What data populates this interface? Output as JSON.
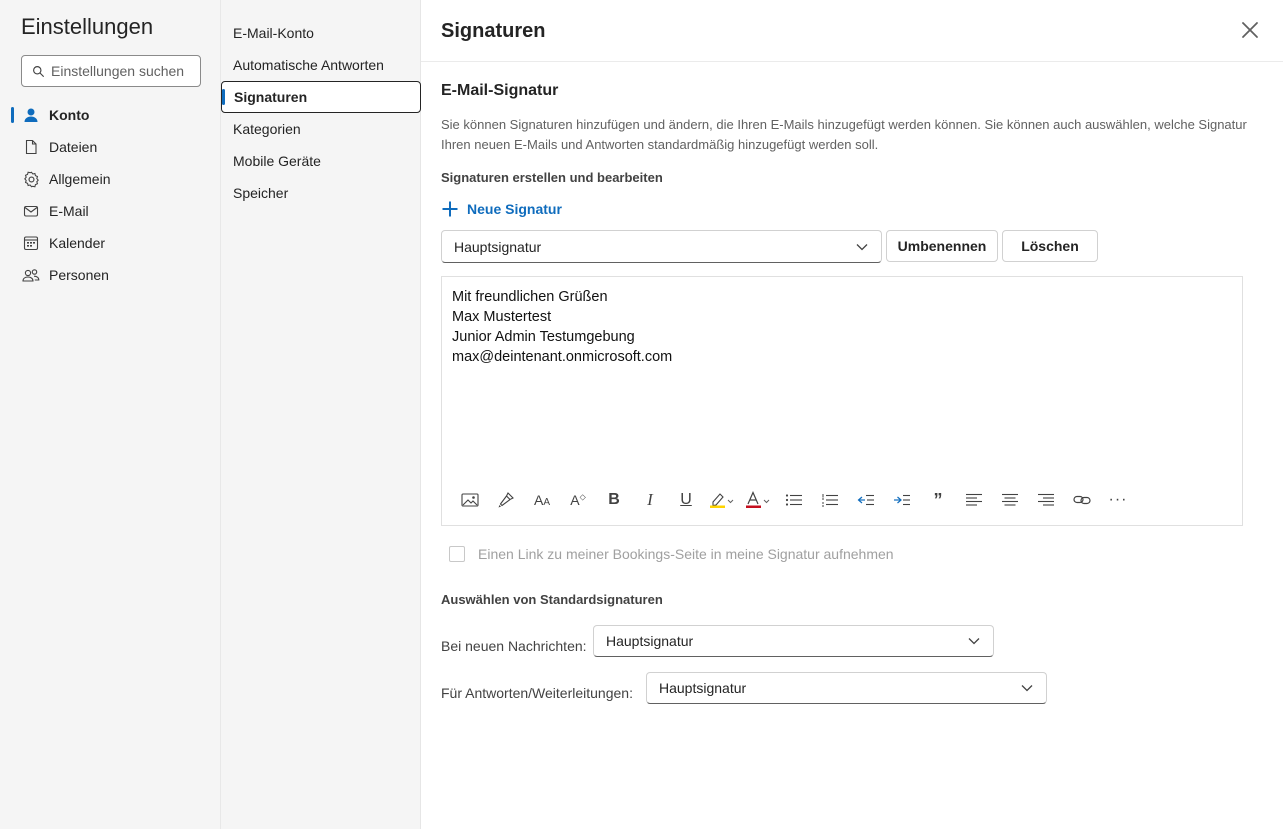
{
  "app": {
    "title": "Einstellungen",
    "search_placeholder": "Einstellungen suchen"
  },
  "nav": [
    {
      "label": "Konto",
      "icon": "person-icon",
      "active": true
    },
    {
      "label": "Dateien",
      "icon": "file-icon",
      "active": false
    },
    {
      "label": "Allgemein",
      "icon": "gear-icon",
      "active": false
    },
    {
      "label": "E-Mail",
      "icon": "mail-icon",
      "active": false
    },
    {
      "label": "Kalender",
      "icon": "calendar-icon",
      "active": false
    },
    {
      "label": "Personen",
      "icon": "people-icon",
      "active": false
    }
  ],
  "subnav": [
    {
      "label": "E-Mail-Konto",
      "active": false
    },
    {
      "label": "Automatische Antworten",
      "active": false
    },
    {
      "label": "Signaturen",
      "active": true
    },
    {
      "label": "Kategorien",
      "active": false
    },
    {
      "label": "Mobile Geräte",
      "active": false
    },
    {
      "label": "Speicher",
      "active": false
    }
  ],
  "panel": {
    "title": "Signaturen",
    "section_title": "E-Mail-Signatur",
    "description": "Sie können Signaturen hinzufügen und ändern, die Ihren E-Mails hinzugefügt werden können. Sie können auch auswählen, welche Signatur Ihren neuen E-Mails und Antworten standardmäßig hinzugefügt werden soll.",
    "create_title": "Signaturen erstellen und bearbeiten",
    "new_signature": "Neue Signatur",
    "selected_signature": "Hauptsignatur",
    "rename_button": "Umbenennen",
    "delete_button": "Löschen",
    "signature_lines": [
      "Mit freundlichen Grüßen",
      "Max Mustertest",
      "Junior Admin Testumgebung",
      "max@deintenant.onmicrosoft.com"
    ],
    "bookings_checkbox": "Einen Link zu meiner Bookings-Seite in meine Signatur aufnehmen",
    "defaults_title": "Auswählen von Standardsignaturen",
    "new_messages_label": "Bei neuen Nachrichten:",
    "new_messages_value": "Hauptsignatur",
    "replies_label": "Für Antworten/Weiterleitungen:",
    "replies_value": "Hauptsignatur"
  },
  "colors": {
    "accent": "#0f6cbd",
    "highlight": "#ffd400",
    "font_color": "#c50f1f"
  }
}
